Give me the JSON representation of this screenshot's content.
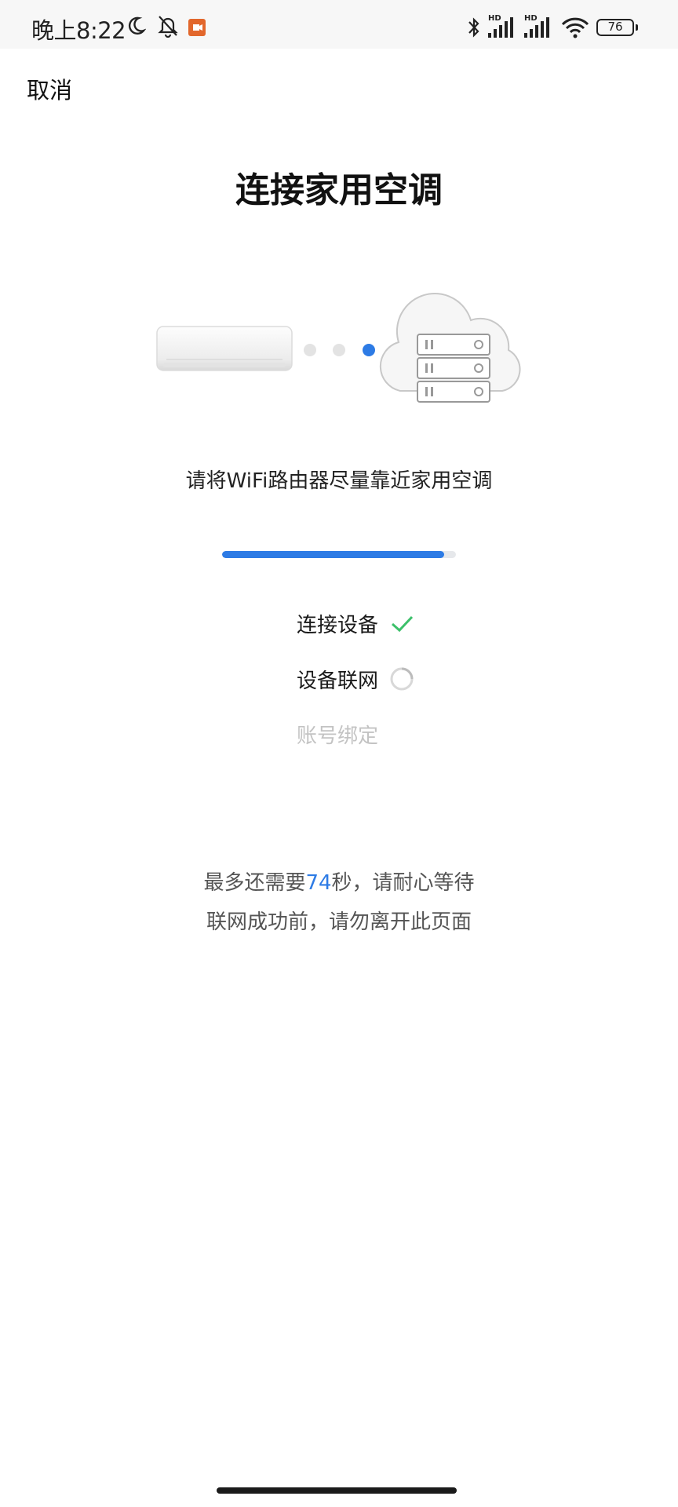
{
  "status_bar": {
    "time": "晚上8:22",
    "battery_level": "76",
    "signal_badge_1": "HD",
    "signal_badge_2": "HD",
    "icons": [
      "moon-icon",
      "bell-off-icon",
      "app-notification-icon",
      "bluetooth-icon",
      "signal-icon",
      "wifi-icon",
      "battery-icon"
    ]
  },
  "header": {
    "cancel_label": "取消",
    "title": "连接家用空调"
  },
  "illustration": {
    "icons": [
      "air-conditioner-icon",
      "connection-dots-icon",
      "cloud-server-icon"
    ],
    "active_dot": 3
  },
  "instruction": "请将WiFi路由器尽量靠近家用空调",
  "progress": {
    "value": 0.95,
    "fill_color": "#2d7be5",
    "track_color": "#e6e8eb"
  },
  "steps": [
    {
      "label": "连接设备",
      "status": "done",
      "icon": "check-icon"
    },
    {
      "label": "设备联网",
      "status": "in-progress",
      "icon": "spinner-icon"
    },
    {
      "label": "账号绑定",
      "status": "pending",
      "icon": ""
    }
  ],
  "wait_message": {
    "prefix": "最多还需要",
    "seconds": "74",
    "suffix": "秒，请耐心等待",
    "line2": "联网成功前，请勿离开此页面"
  },
  "colors": {
    "accent": "#2d7be5",
    "success": "#3cc06a"
  }
}
